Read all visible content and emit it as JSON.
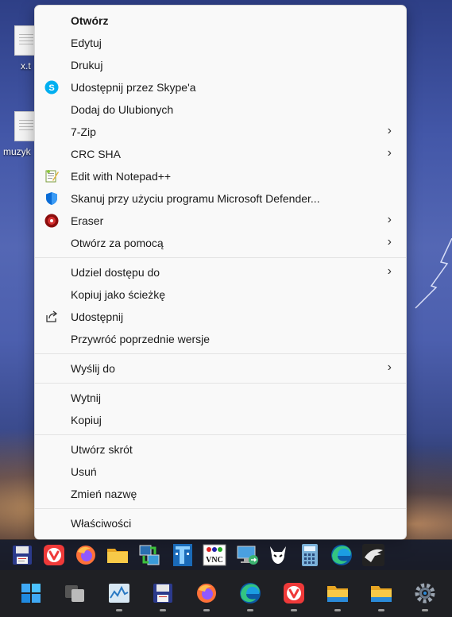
{
  "desktop": {
    "icons": [
      {
        "label": "x.t"
      },
      {
        "label": "muzyk"
      }
    ]
  },
  "context_menu": {
    "groups": [
      [
        {
          "label": "Otwórz",
          "icon": "none",
          "submenu": false,
          "bold": true
        },
        {
          "label": "Edytuj",
          "icon": "none",
          "submenu": false
        },
        {
          "label": "Drukuj",
          "icon": "none",
          "submenu": false
        },
        {
          "label": "Udostępnij przez Skype'a",
          "icon": "skype-icon",
          "submenu": false
        },
        {
          "label": "Dodaj do Ulubionych",
          "icon": "none",
          "submenu": false
        },
        {
          "label": "7-Zip",
          "icon": "none",
          "submenu": true
        },
        {
          "label": "CRC SHA",
          "icon": "none",
          "submenu": true
        },
        {
          "label": "Edit with Notepad++",
          "icon": "notepadpp-icon",
          "submenu": false
        },
        {
          "label": "Skanuj przy użyciu programu Microsoft Defender...",
          "icon": "defender-shield-icon",
          "submenu": false
        },
        {
          "label": "Eraser",
          "icon": "eraser-icon",
          "submenu": true
        },
        {
          "label": "Otwórz za pomocą",
          "icon": "none",
          "submenu": true
        }
      ],
      [
        {
          "label": "Udziel dostępu do",
          "icon": "none",
          "submenu": true
        },
        {
          "label": "Kopiuj jako ścieżkę",
          "icon": "none",
          "submenu": false
        },
        {
          "label": "Udostępnij",
          "icon": "share-icon",
          "submenu": false
        },
        {
          "label": "Przywróć poprzednie wersje",
          "icon": "none",
          "submenu": false
        }
      ],
      [
        {
          "label": "Wyślij do",
          "icon": "none",
          "submenu": true
        }
      ],
      [
        {
          "label": "Wytnij",
          "icon": "none",
          "submenu": false
        },
        {
          "label": "Kopiuj",
          "icon": "none",
          "submenu": false
        }
      ],
      [
        {
          "label": "Utwórz skrót",
          "icon": "none",
          "submenu": false
        },
        {
          "label": "Usuń",
          "icon": "none",
          "submenu": false
        },
        {
          "label": "Zmień nazwę",
          "icon": "none",
          "submenu": false
        }
      ],
      [
        {
          "label": "Właściwości",
          "icon": "none",
          "submenu": false
        }
      ]
    ]
  },
  "quick_launch": {
    "icons": [
      "save-floppy-icon",
      "vivaldi-icon",
      "firefox-icon",
      "folder-icon",
      "network-transfer-icon",
      "terminal-app-icon",
      "vnc-icon",
      "remote-desktop-icon",
      "foobar-icon",
      "calculator-icon",
      "edge-icon",
      "eagle-app-icon"
    ],
    "vnc_text": "VNC"
  },
  "taskbar": {
    "icons": [
      "windows-start-icon",
      "task-view-icon",
      "task-manager-icon",
      "save-floppy-icon",
      "firefox-icon",
      "edge-icon",
      "vivaldi-icon",
      "file-explorer-icon",
      "file-explorer-icon",
      "settings-gear-icon"
    ]
  },
  "colors": {
    "menu_bg": "#f9f9f9",
    "separator": "#e3e3e3",
    "taskbar_bg": "#1f2024",
    "skype": "#00aff0",
    "defender": "#0a6cd6",
    "vivaldi": "#ef3939",
    "firefox": "#ff7139",
    "folder": "#f7c948"
  }
}
